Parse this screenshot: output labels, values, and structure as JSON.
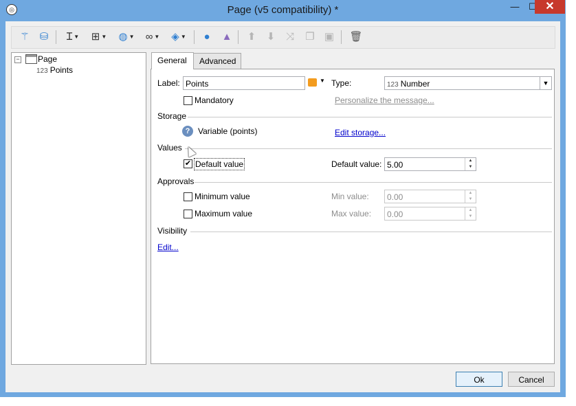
{
  "window": {
    "title": "Page (v5 compatibility) *",
    "app_icon": "adobe-campaign-icon"
  },
  "titlebar": {
    "min_glyph": "—",
    "max_glyph": "☐",
    "close_glyph": "✕"
  },
  "toolbar": {
    "icons": [
      "wand-icon",
      "database-icon",
      "text-cursor-icon",
      "form-icon",
      "globe-icon",
      "link-icon",
      "package-icon",
      "person-icon",
      "shapes-icon",
      "arrow-up-icon",
      "arrow-down-icon",
      "shuffle-icon",
      "copy-icon",
      "paste-icon",
      "trash-icon"
    ]
  },
  "tree": {
    "root": {
      "expander": "−",
      "label": "Page"
    },
    "child": {
      "badge": "123",
      "label": "Points"
    }
  },
  "tabs": [
    {
      "label": "General"
    },
    {
      "label": "Advanced"
    }
  ],
  "general": {
    "label_caption": "Label:",
    "label_value": "Points",
    "type_caption": "Type:",
    "type_badge": "123",
    "type_value": "Number",
    "mandatory_label": "Mandatory",
    "personalize_link": "Personalize the message...",
    "storage_title": "Storage",
    "storage_help": "?",
    "storage_variable": "Variable (points)",
    "edit_storage_link": "Edit storage...",
    "values_title": "Values",
    "default_value_check_label": "Default value",
    "default_value_caption": "Default value:",
    "default_value": "5.00",
    "approvals_title": "Approvals",
    "minimum_label": "Minimum value",
    "min_caption": "Min value:",
    "min_value": "0.00",
    "maximum_label": "Maximum value",
    "max_caption": "Max value:",
    "max_value": "0.00",
    "visibility_title": "Visibility",
    "edit_visibility_link": "Edit..."
  },
  "state": {
    "default_value_checked": true,
    "mandatory_checked": false,
    "minimum_checked": false,
    "maximum_checked": false
  },
  "footer": {
    "ok_label": "Ok",
    "cancel_label": "Cancel"
  }
}
